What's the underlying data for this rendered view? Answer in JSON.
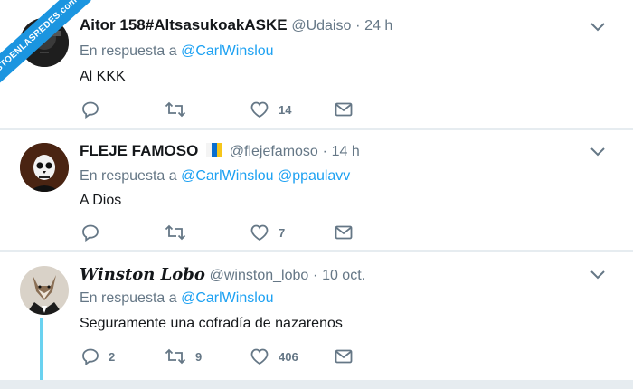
{
  "watermark": {
    "text": "VISTOENLASREDES.com"
  },
  "tweets": [
    {
      "name": "Aitor 158#AltsasukoakASKE",
      "handle": "@Udaiso",
      "dot": "·",
      "time": "24 h",
      "reply_prefix": "En respuesta a",
      "reply_to": [
        "@CarlWinslou"
      ],
      "text": "Al KKK",
      "reply_count": "",
      "retweet_count": "",
      "like_count": "14"
    },
    {
      "name": "FLEJE FAMOSO",
      "handle": "@flejefamoso",
      "dot": "·",
      "time": "14 h",
      "reply_prefix": "En respuesta a",
      "reply_to": [
        "@CarlWinslou",
        "@ppaulavv"
      ],
      "text": "A Dios",
      "reply_count": "",
      "retweet_count": "",
      "like_count": "7"
    },
    {
      "name": "Winston Lobo",
      "handle": "@winston_lobo",
      "dot": "·",
      "time": "10 oct.",
      "reply_prefix": "En respuesta a",
      "reply_to": [
        "@CarlWinslou"
      ],
      "text": "Seguramente una cofradía de nazarenos",
      "reply_count": "2",
      "retweet_count": "9",
      "like_count": "406"
    }
  ],
  "colors": {
    "link": "#1da1f2",
    "muted": "#657786",
    "background": "#e6ecf0",
    "thread_line": "#6ad2f0"
  }
}
